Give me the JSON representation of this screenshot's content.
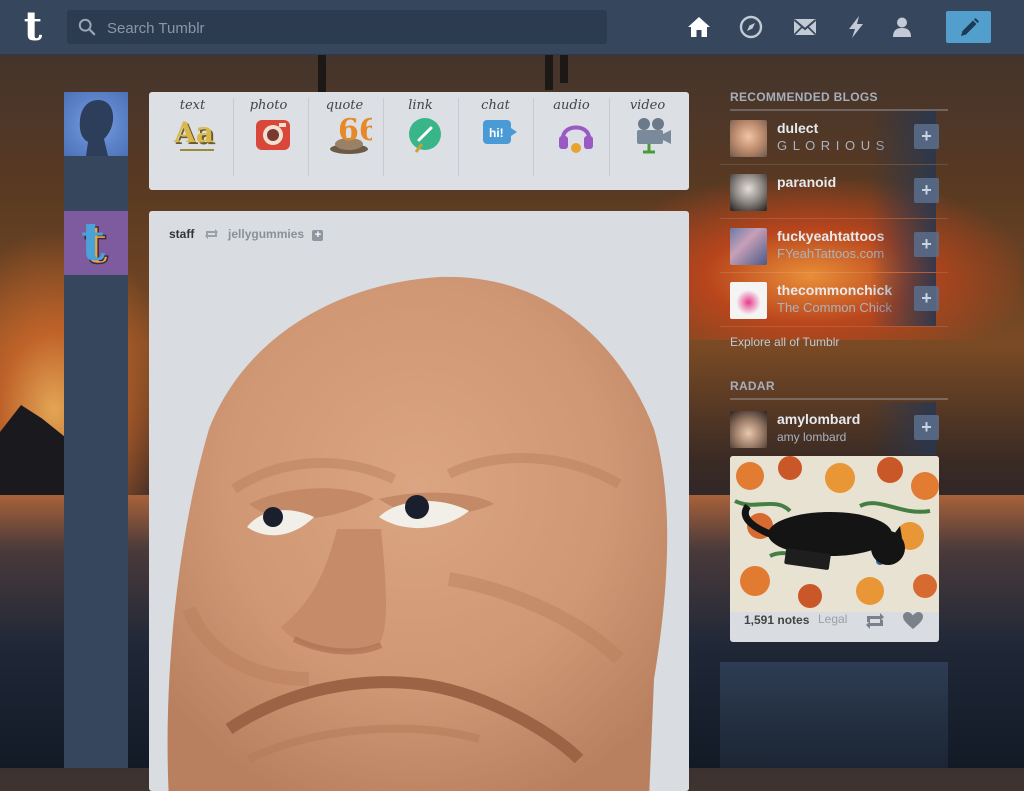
{
  "topbar": {
    "logo": "t",
    "search_placeholder": "Search Tumblr",
    "nav_icons": [
      "home-icon",
      "explore-icon",
      "inbox-icon",
      "activity-icon",
      "account-icon"
    ],
    "compose_icon": "pencil-icon"
  },
  "post_types": [
    {
      "label": "text",
      "icon": "text-icon"
    },
    {
      "label": "photo",
      "icon": "photo-icon"
    },
    {
      "label": "quote",
      "icon": "quote-icon"
    },
    {
      "label": "link",
      "icon": "link-icon"
    },
    {
      "label": "chat",
      "icon": "chat-icon"
    },
    {
      "label": "audio",
      "icon": "audio-icon"
    },
    {
      "label": "video",
      "icon": "video-icon"
    }
  ],
  "post": {
    "author": "staff",
    "reblogged_from": "jellygummies",
    "follow_label": "+"
  },
  "sidebar": {
    "recommended_heading": "RECOMMENDED BLOGS",
    "recommended": [
      {
        "name": "dulect",
        "subtitle": "G L O R I O U S",
        "add": "+"
      },
      {
        "name": "paranoid",
        "subtitle": "",
        "add": "+"
      },
      {
        "name": "fuckyeahtattoos",
        "subtitle": "FYeahTattoos.com",
        "add": "+"
      },
      {
        "name": "thecommonchick",
        "subtitle": "The Common Chick",
        "add": "+"
      }
    ],
    "explore_link": "Explore all of Tumblr",
    "radar_heading": "RADAR",
    "radar": {
      "name": "amylombard",
      "subtitle": "amy lombard",
      "add": "+",
      "notes": "1,591 notes",
      "footer_text": "Legal"
    }
  },
  "colors": {
    "topbar": "#36465d",
    "compose": "#529ecc",
    "panel": "#dcdfe4"
  }
}
